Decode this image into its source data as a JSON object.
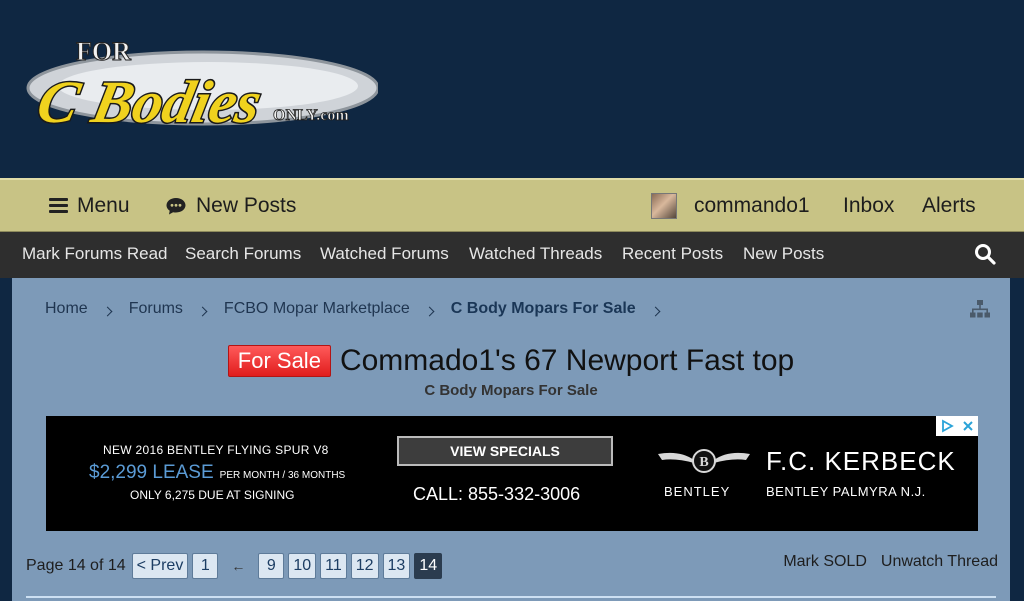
{
  "header": {
    "logo": {
      "line1": "FOR",
      "line2": "C Bodies",
      "line3": "ONLY.com"
    }
  },
  "mainnav": {
    "menu_label": "Menu",
    "new_posts_label": "New Posts",
    "username": "commando1",
    "inbox_label": "Inbox",
    "alerts_label": "Alerts"
  },
  "subnav": {
    "items": [
      "Mark Forums Read",
      "Search Forums",
      "Watched Forums",
      "Watched Threads",
      "Recent Posts",
      "New Posts"
    ]
  },
  "breadcrumb": [
    "Home",
    "Forums",
    "FCBO Mopar Marketplace",
    "C Body Mopars For Sale"
  ],
  "thread": {
    "prefix": "For Sale",
    "title": "Commado1's 67 Newport Fast top",
    "forum": "C Body Mopars For Sale"
  },
  "ad": {
    "line1": "NEW 2016 BENTLEY FLYING SPUR V8",
    "lease": "$2,299 LEASE",
    "lease_terms": "PER MONTH / 36 MONTHS",
    "line3": "ONLY 6,275 DUE AT SIGNING",
    "cta": "VIEW SPECIALS",
    "call": "CALL: 855-332-3006",
    "brand": "BENTLEY",
    "dealer": "F.C. KERBECK",
    "dealer_sub": "BENTLEY PALMYRA N.J."
  },
  "pager": {
    "label": "Page 14 of 14",
    "prev": "< Prev",
    "first": "1",
    "ellipsis_arrow": "←",
    "pages": [
      "9",
      "10",
      "11",
      "12",
      "13"
    ],
    "current": "14"
  },
  "actions": {
    "mark_sold": "Mark SOLD",
    "unwatch": "Unwatch Thread"
  },
  "colors": {
    "header_bg": "#0f2742",
    "nav_bg": "#c8c385",
    "subnav_bg": "#2e2e2e",
    "panel_bg": "#7d9ab8",
    "prefix_red": "#e11d1d"
  }
}
